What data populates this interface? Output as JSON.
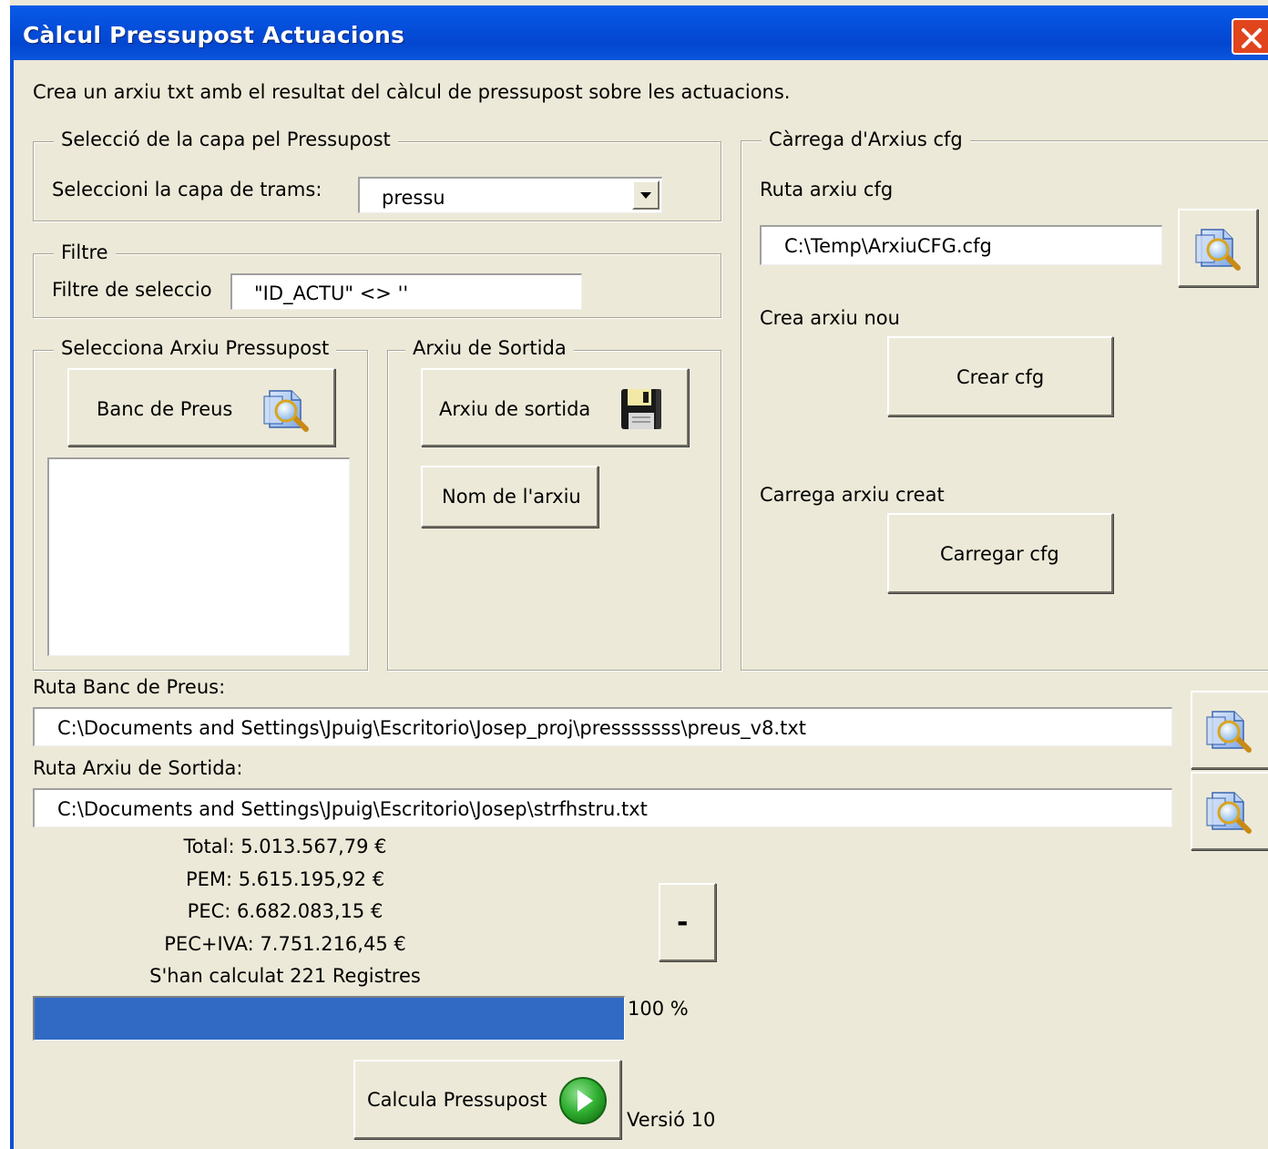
{
  "window": {
    "title": "Càlcul Pressupost Actuacions"
  },
  "description": "Crea un arxiu txt amb el resultat del càlcul de pressupost sobre les actuacions.",
  "layer_group": {
    "legend": "Selecció de la capa pel Pressupost",
    "label": "Seleccioni la capa de trams:",
    "selected": "pressu"
  },
  "filter_group": {
    "legend": "Filtre",
    "label": "Filtre de seleccio",
    "value": "\"ID_ACTU\" <> ''"
  },
  "budget_file_group": {
    "legend": "Selecciona Arxiu Pressupost",
    "button_label": "Banc de Preus"
  },
  "output_group": {
    "legend": "Arxiu de Sortida",
    "output_button_label": "Arxiu de sortida",
    "name_button_label": "Nom de l'arxiu"
  },
  "cfg_group": {
    "legend": "Càrrega d'Arxius cfg",
    "path_label": "Ruta arxiu cfg",
    "path_value": "C:\\Temp\\ArxiuCFG.cfg",
    "new_label": "Crea arxiu nou",
    "create_button_label": "Crear cfg",
    "load_label": "Carrega arxiu creat",
    "load_button_label": "Carregar cfg"
  },
  "price_bank": {
    "label": "Ruta Banc de Preus:",
    "path": "C:\\Documents and Settings\\Jpuig\\Escritorio\\Josep_proj\\presssssss\\preus_v8.txt"
  },
  "output_path": {
    "label": "Ruta Arxiu de Sortida:",
    "path": "C:\\Documents and Settings\\Jpuig\\Escritorio\\Josep\\strfhstru.txt"
  },
  "results": {
    "total": "Total: 5.013.567,79 €",
    "pem": "PEM: 5.615.195,92 €",
    "pec": "PEC: 6.682.083,15 €",
    "pec_iva": "PEC+IVA: 7.751.216,45 €",
    "records": "S'han calculat 221 Registres"
  },
  "collapse_button_label": "-",
  "progress": {
    "value": 100,
    "text": "100 %"
  },
  "calculate_button_label": "Calcula Pressupost",
  "version": "Versió 10",
  "icons": {
    "search": "file-search-icon",
    "save": "floppy-disk-icon",
    "run": "play-icon",
    "close": "close-icon"
  },
  "colors": {
    "titlebar": "#0550dd",
    "window_bg": "#ece9d8",
    "progress_fill": "#316ac5",
    "close": "#e0451e",
    "run_icon": "#2fae2f"
  }
}
